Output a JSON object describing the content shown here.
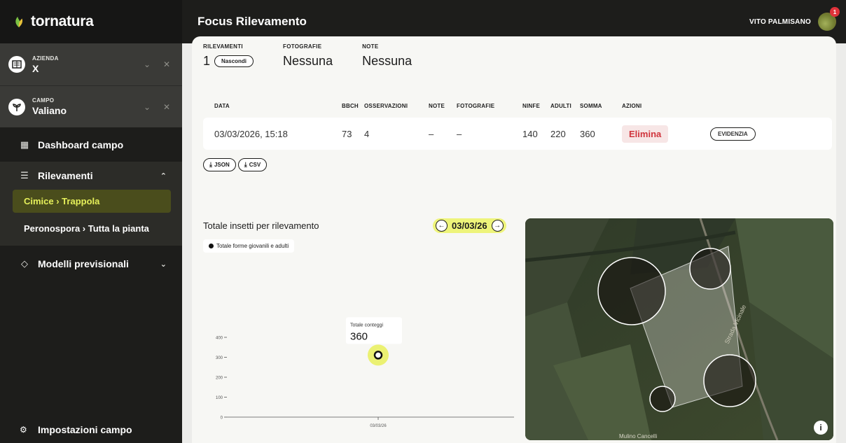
{
  "app": {
    "logo_text": "tornatura"
  },
  "header": {
    "title": "Focus Rilevamento",
    "user_name": "VITO PALMISANO",
    "notifications": "1"
  },
  "sidebar": {
    "azienda": {
      "label": "AZIENDA",
      "value": "X"
    },
    "campo": {
      "label": "CAMPO",
      "value": "Valiano"
    },
    "dashboard": "Dashboard campo",
    "rilevamenti": "Rilevamenti",
    "sub_items": [
      "Cimice › Trappola",
      "Peronospora › Tutta la pianta"
    ],
    "modelli": "Modelli previsionali",
    "impostazioni": "Impostazioni campo"
  },
  "summary": {
    "rilevamenti_label": "RILEVAMENTI",
    "rilevamenti_value": "1",
    "hide_button": "Nascondi",
    "fotografie_label": "FOTOGRAFIE",
    "fotografie_value": "Nessuna",
    "note_label": "NOTE",
    "note_value": "Nessuna"
  },
  "table": {
    "headers": [
      "DATA",
      "BBCH",
      "OSSERVAZIONI",
      "NOTE",
      "FOTOGRAFIE",
      "NINFE",
      "ADULTI",
      "SOMMA",
      "AZIONI"
    ],
    "rows": [
      {
        "data": "03/03/2026, 15:18",
        "bbch": "73",
        "osservazioni": "4",
        "note": "–",
        "fotografie": "–",
        "ninfe": "140",
        "adulti": "220",
        "somma": "360",
        "delete": "Elimina",
        "highlight": "EVIDENZIA"
      }
    ]
  },
  "exports": {
    "json": "JSON",
    "csv": "CSV"
  },
  "chart_section": {
    "title": "Totale insetti per rilevamento",
    "date": "03/03/26",
    "tooltip_label": "Totale conteggi",
    "tooltip_value": "360"
  },
  "chart_data": {
    "type": "scatter",
    "title": "Totale insetti per rilevamento",
    "series": [
      {
        "name": "Totale forme giovanili e adulti",
        "x": [
          "03/03/26"
        ],
        "values": [
          360
        ]
      }
    ],
    "categories": [
      "03/03/26"
    ],
    "yticks": [
      "0",
      "100",
      "200",
      "300",
      "400"
    ],
    "ylim": [
      0,
      400
    ],
    "grid": false,
    "legend": "top-left"
  },
  "map": {
    "label": "Mulino Cancelli",
    "road": "Strada Vicinale"
  },
  "colors": {
    "accent": "#e6f05a",
    "danger": "#d0343c",
    "dark": "#1d1d1b"
  }
}
